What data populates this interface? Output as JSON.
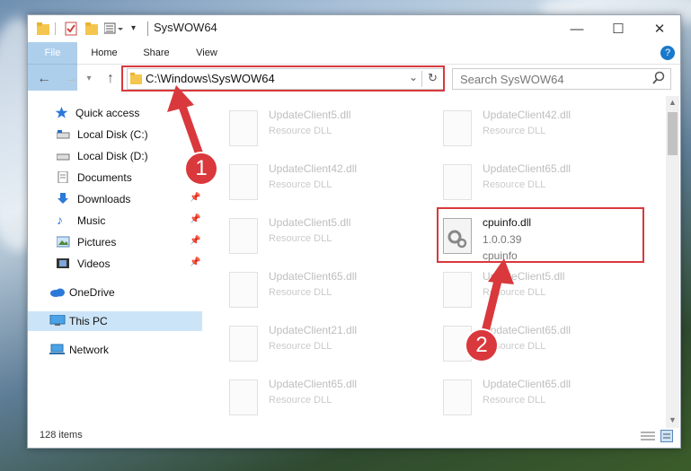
{
  "window": {
    "title": "SysWOW64"
  },
  "ribbon": {
    "tabs": [
      "File",
      "Home",
      "Share",
      "View"
    ],
    "help": "?"
  },
  "address": {
    "path": "C:\\Windows\\SysWOW64"
  },
  "search": {
    "placeholder": "Search SysWOW64"
  },
  "sidebar": {
    "items": [
      {
        "label": "Quick access",
        "icon": "star-icon"
      },
      {
        "label": "Local Disk (C:)",
        "icon": "drive-icon"
      },
      {
        "label": "Local Disk (D:)",
        "icon": "drive-icon"
      },
      {
        "label": "Documents",
        "icon": "documents-icon"
      },
      {
        "label": "Downloads",
        "icon": "download-icon"
      },
      {
        "label": "Music",
        "icon": "music-icon"
      },
      {
        "label": "Pictures",
        "icon": "pictures-icon"
      },
      {
        "label": "Videos",
        "icon": "videos-icon"
      },
      {
        "label": "OneDrive",
        "icon": "cloud-icon"
      },
      {
        "label": "This PC",
        "icon": "computer-icon"
      },
      {
        "label": "Network",
        "icon": "network-icon"
      }
    ]
  },
  "files": [
    {
      "name": "UpdateClient5.dll",
      "desc": "Resource DLL"
    },
    {
      "name": "UpdateClient42.dll",
      "desc": "Resource DLL"
    },
    {
      "name": "UpdateClient42.dll",
      "desc": "Resource DLL"
    },
    {
      "name": "UpdateClient65.dll",
      "desc": "Resource DLL"
    },
    {
      "name": "UpdateClient5.dll",
      "desc": "Resource DLL"
    },
    {
      "name": "UpdateClient65.dll",
      "desc": "Resource DLL"
    },
    {
      "name": "UpdateClient5.dll",
      "desc": "Resource DLL"
    },
    {
      "name": "UpdateClient21.dll",
      "desc": "Resource DLL"
    },
    {
      "name": "UpdateClient65.dll",
      "desc": "Resource DLL"
    },
    {
      "name": "UpdateClient65.dll",
      "desc": "Resource DLL"
    },
    {
      "name": "UpdateClient65.dll",
      "desc": "Resource DLL"
    }
  ],
  "highlighted_file": {
    "name": "cpuinfo.dll",
    "version": "1.0.0.39",
    "company": "cpuinfo"
  },
  "status": {
    "item_count": "128 items"
  },
  "annotations": {
    "step1": "1",
    "step2": "2",
    "color": "#d9383c"
  },
  "colors": {
    "accent": "#1979ca",
    "selected": "#cce4f7"
  }
}
